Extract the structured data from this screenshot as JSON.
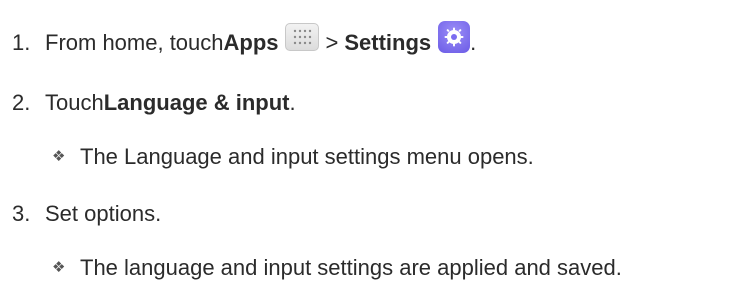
{
  "steps": [
    {
      "number": "1.",
      "prefix": "From home, touch ",
      "apps_label": "Apps",
      "separator": " > ",
      "settings_label": "Settings",
      "suffix": "."
    },
    {
      "number": "2.",
      "prefix": "Touch ",
      "bold": "Language & input",
      "suffix": "."
    },
    {
      "bullet": "❖",
      "text": "The Language and input settings menu opens."
    },
    {
      "number": "3.",
      "text": "Set options."
    },
    {
      "bullet": "❖",
      "text": "The language and input settings are applied and saved."
    }
  ],
  "icons": {
    "apps": "apps-icon",
    "settings": "settings-icon"
  },
  "colors": {
    "text": "#2b2b2b",
    "settings_icon": "#7b6cf0"
  }
}
